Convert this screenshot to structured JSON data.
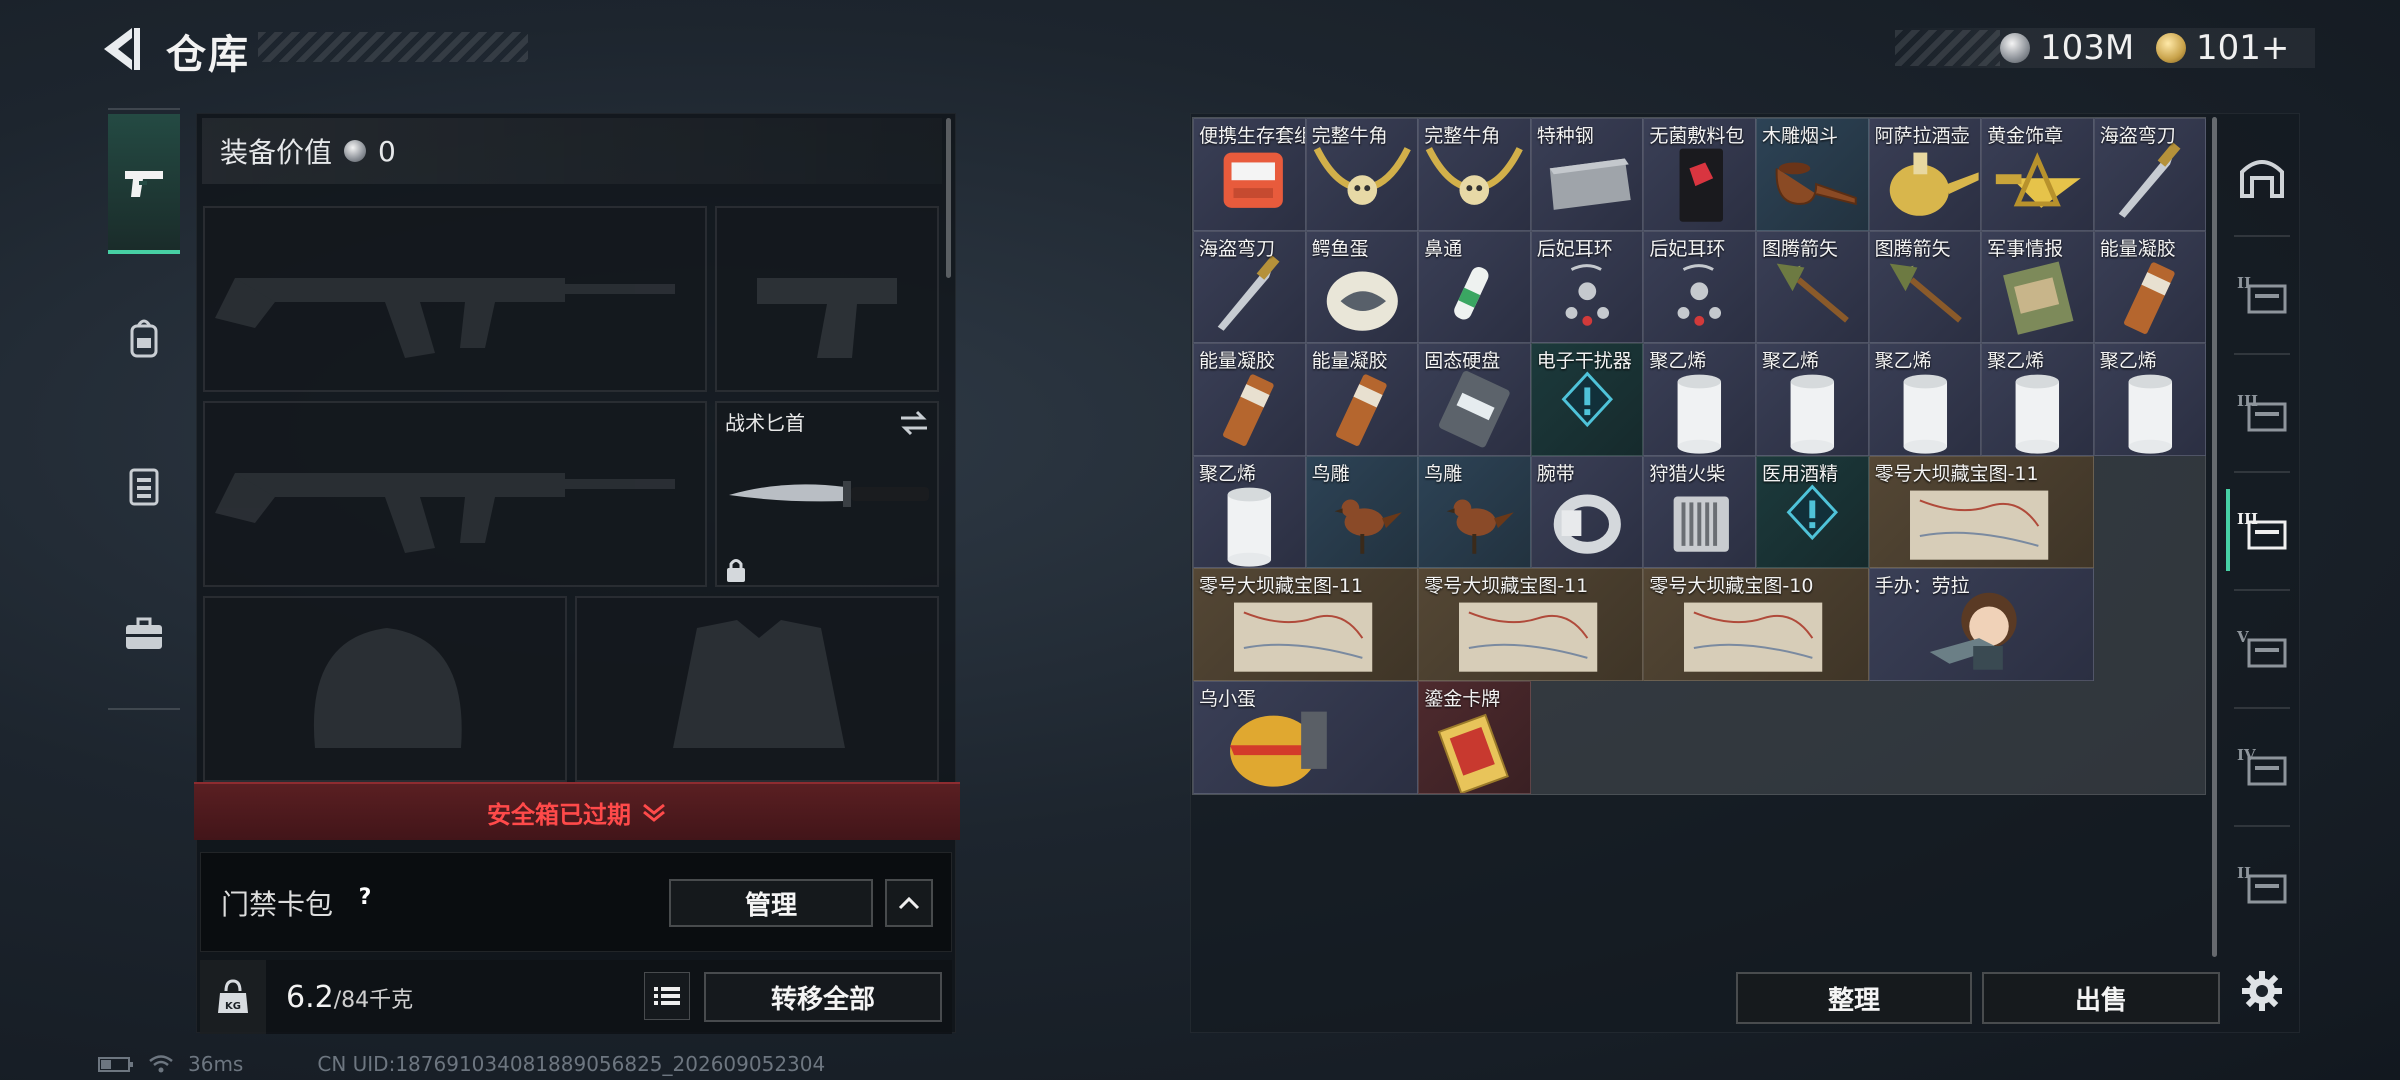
{
  "header": {
    "title": "仓库",
    "currency_silver": "103M",
    "currency_gold": "101+"
  },
  "left_nav": {
    "items": [
      {
        "name": "weapon-tab",
        "icon": "pistol-icon",
        "active": true
      },
      {
        "name": "backpack-tab",
        "icon": "backpack-icon",
        "active": false
      },
      {
        "name": "chest-rig-tab",
        "icon": "vest-icon",
        "active": false
      },
      {
        "name": "case-tab",
        "icon": "briefcase-icon",
        "active": false
      }
    ]
  },
  "equipment": {
    "value_label": "装备价值",
    "value": "0",
    "melee_label": "战术匕首",
    "secure_case_text": "安全箱已过期",
    "card_bag_label": "门禁卡包",
    "help_label": "?",
    "manage_button": "管理",
    "weight_current": "6.2",
    "weight_max": "/84千克",
    "weight_icon_text": "KG",
    "transfer_all_button": "转移全部"
  },
  "status": {
    "ping": "36ms",
    "uid": "CN UID:18769103408188905682​5_202609052304"
  },
  "stash": {
    "items": [
      {
        "label": "便携生存套组",
        "quality": "q-purple",
        "art": "kit"
      },
      {
        "label": "完整牛角",
        "quality": "q-purple",
        "art": "horn"
      },
      {
        "label": "完整牛角",
        "quality": "q-purple",
        "art": "horn"
      },
      {
        "label": "特种钢",
        "quality": "q-purple",
        "art": "steel"
      },
      {
        "label": "无菌敷料包",
        "quality": "q-purple",
        "art": "pack"
      },
      {
        "label": "木雕烟斗",
        "quality": "q-blue",
        "art": "pipe"
      },
      {
        "label": "阿萨拉酒壶",
        "quality": "q-purple",
        "art": "jug"
      },
      {
        "label": "黄金饰章",
        "quality": "q-purple",
        "art": "badge"
      },
      {
        "label": "海盗弯刀",
        "quality": "q-purple",
        "art": "dagger"
      },
      {
        "label": "海盗弯刀",
        "quality": "q-purple",
        "art": "dagger"
      },
      {
        "label": "鳄鱼蛋",
        "quality": "q-purple",
        "art": "egg"
      },
      {
        "label": "鼻通",
        "quality": "q-purple",
        "art": "inhaler"
      },
      {
        "label": "后妃耳环",
        "quality": "q-purple",
        "art": "earring"
      },
      {
        "label": "后妃耳环",
        "quality": "q-purple",
        "art": "earring"
      },
      {
        "label": "图腾箭矢",
        "quality": "q-purple",
        "art": "arrow"
      },
      {
        "label": "图腾箭矢",
        "quality": "q-purple",
        "art": "arrow"
      },
      {
        "label": "军事情报",
        "quality": "q-purple",
        "art": "intel"
      },
      {
        "label": "能量凝胶",
        "quality": "q-purple",
        "art": "gel"
      },
      {
        "label": "能量凝胶",
        "quality": "q-purple",
        "art": "gel"
      },
      {
        "label": "能量凝胶",
        "quality": "q-purple",
        "art": "gel"
      },
      {
        "label": "固态硬盘",
        "quality": "q-purple",
        "art": "ssd"
      },
      {
        "label": "电子干扰器",
        "quality": "q-teal",
        "art": "jammer"
      },
      {
        "label": "聚乙烯",
        "quality": "q-purple",
        "art": "roll"
      },
      {
        "label": "聚乙烯",
        "quality": "q-purple",
        "art": "roll"
      },
      {
        "label": "聚乙烯",
        "quality": "q-purple",
        "art": "roll"
      },
      {
        "label": "聚乙烯",
        "quality": "q-purple",
        "art": "roll"
      },
      {
        "label": "聚乙烯",
        "quality": "q-purple",
        "art": "roll"
      },
      {
        "label": "聚乙烯",
        "quality": "q-purple",
        "art": "roll"
      },
      {
        "label": "鸟雕",
        "quality": "q-blue",
        "art": "bird"
      },
      {
        "label": "鸟雕",
        "quality": "q-blue",
        "art": "bird"
      },
      {
        "label": "腕带",
        "quality": "q-purple",
        "art": "band"
      },
      {
        "label": "狩猎火柴",
        "quality": "q-purple",
        "art": "matches"
      },
      {
        "label": "医用酒精",
        "quality": "q-teal",
        "art": "jammer"
      },
      {
        "label": "零号大坝藏宝图-11",
        "quality": "q-gold",
        "art": "map",
        "wide": true
      },
      {
        "label": "零号大坝藏宝图-11",
        "quality": "q-gold",
        "art": "map",
        "wide": true
      },
      {
        "label": "零号大坝藏宝图-11",
        "quality": "q-gold",
        "art": "map",
        "wide": true
      },
      {
        "label": "零号大坝藏宝图-10",
        "quality": "q-gold",
        "art": "map",
        "wide": true
      },
      {
        "label": "手办：劳拉",
        "quality": "q-purple",
        "art": "figure",
        "wide": true
      },
      {
        "label": "乌小蛋",
        "quality": "q-purple",
        "art": "eggfig",
        "wide": true
      },
      {
        "label": "鎏金卡牌",
        "quality": "q-red",
        "art": "card"
      }
    ],
    "sort_button": "整理",
    "sell_button": "出售"
  },
  "right_nav": {
    "items": [
      {
        "name": "stash-home-tab",
        "icon": "arch-icon",
        "label": ""
      },
      {
        "name": "stash-page-1-tab",
        "icon": "crate-icon",
        "label": "II"
      },
      {
        "name": "stash-page-2-tab",
        "icon": "crate-icon",
        "label": "III"
      },
      {
        "name": "stash-page-3-tab",
        "icon": "crate-icon",
        "label": "III"
      },
      {
        "name": "stash-page-4-tab",
        "icon": "crate-icon",
        "label": "V"
      },
      {
        "name": "stash-page-5-tab",
        "icon": "crate-icon",
        "label": "IV"
      },
      {
        "name": "stash-page-6-tab",
        "icon": "crate-icon",
        "label": "II"
      }
    ],
    "settings_icon": "gear-icon"
  }
}
